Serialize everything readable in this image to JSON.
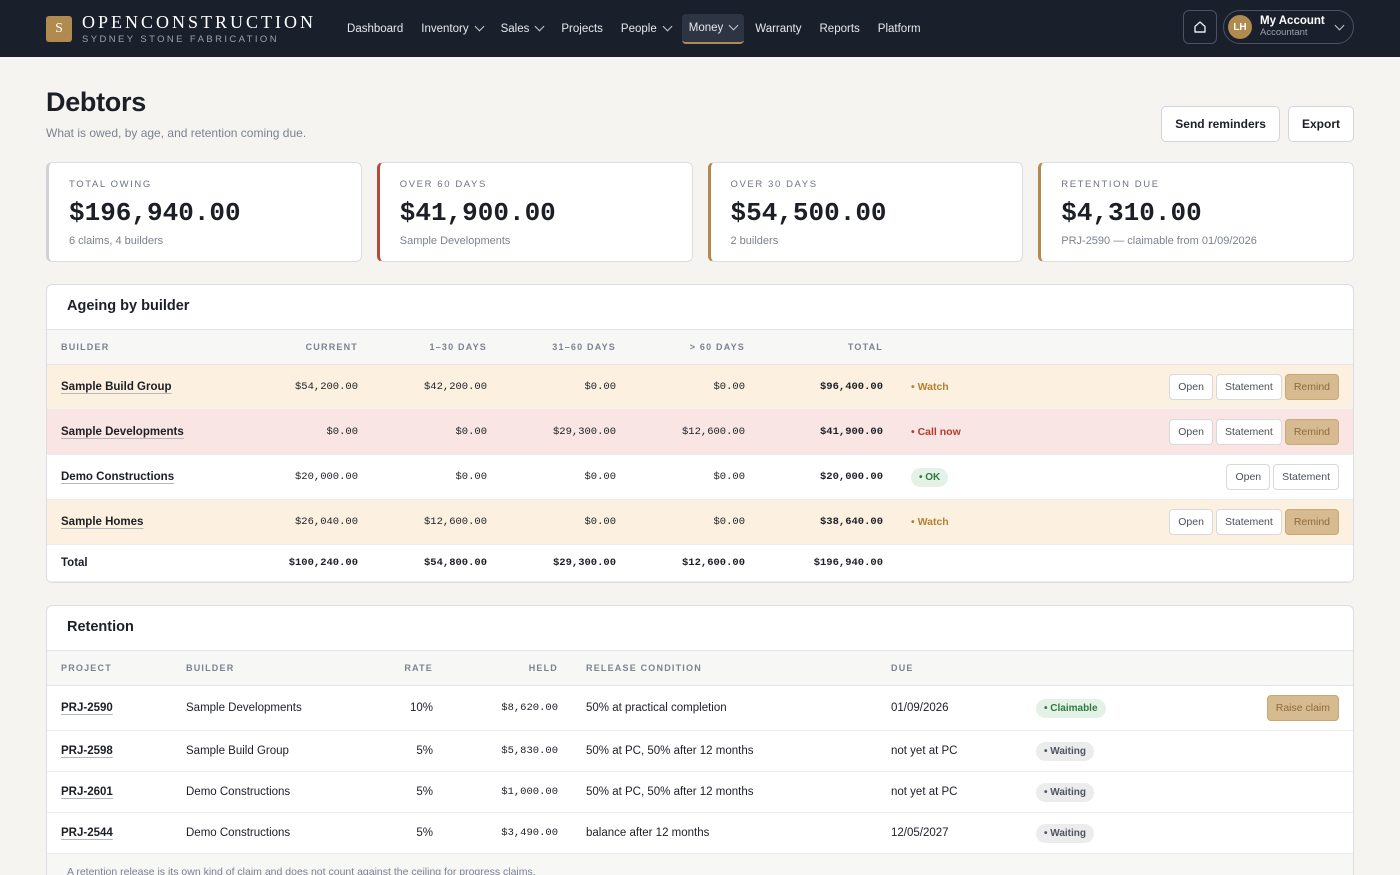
{
  "brand": {
    "mark": "S",
    "name": "OPENCONSTRUCTION",
    "sub": "SYDNEY STONE FABRICATION"
  },
  "nav": [
    {
      "label": "Dashboard",
      "dropdown": false,
      "active": false
    },
    {
      "label": "Inventory",
      "dropdown": true,
      "active": false
    },
    {
      "label": "Sales",
      "dropdown": true,
      "active": false
    },
    {
      "label": "Projects",
      "dropdown": false,
      "active": false
    },
    {
      "label": "People",
      "dropdown": true,
      "active": false
    },
    {
      "label": "Money",
      "dropdown": true,
      "active": true
    },
    {
      "label": "Warranty",
      "dropdown": false,
      "active": false
    },
    {
      "label": "Reports",
      "dropdown": false,
      "active": false
    },
    {
      "label": "Platform",
      "dropdown": false,
      "active": false
    }
  ],
  "account": {
    "initials": "LH",
    "name": "My Account",
    "role": "Accountant"
  },
  "page": {
    "title": "Debtors",
    "subtitle": "What is owed, by age, and retention coming due.",
    "send_label": "Send reminders",
    "export_label": "Export"
  },
  "cards": [
    {
      "label": "TOTAL OWING",
      "value": "$196,940.00",
      "note": "6 claims, 4 builders",
      "accent": "neutral"
    },
    {
      "label": "OVER 60 DAYS",
      "value": "$41,900.00",
      "note": "Sample Developments",
      "accent": "red"
    },
    {
      "label": "OVER 30 DAYS",
      "value": "$54,500.00",
      "note": "2 builders",
      "accent": "gold"
    },
    {
      "label": "RETENTION DUE",
      "value": "$4,310.00",
      "note": "PRJ-2590 — claimable from 01/09/2026",
      "accent": "gold"
    }
  ],
  "ageing": {
    "title": "Ageing by builder",
    "columns": [
      "BUILDER",
      "CURRENT",
      "1–30 DAYS",
      "31–60 DAYS",
      "> 60 DAYS",
      "TOTAL"
    ],
    "rows": [
      {
        "builder": "Sample Build Group",
        "current": "$54,200.00",
        "d30": "$42,200.00",
        "d60": "$0.00",
        "over60": "$0.00",
        "total": "$96,400.00",
        "status": "Watch",
        "status_type": "watch",
        "remind": true
      },
      {
        "builder": "Sample Developments",
        "current": "$0.00",
        "d30": "$0.00",
        "d60": "$29,300.00",
        "over60": "$12,600.00",
        "total": "$41,900.00",
        "status": "Call now",
        "status_type": "call",
        "remind": true
      },
      {
        "builder": "Demo Constructions",
        "current": "$20,000.00",
        "d30": "$0.00",
        "d60": "$0.00",
        "over60": "$0.00",
        "total": "$20,000.00",
        "status": "OK",
        "status_type": "ok",
        "remind": false
      },
      {
        "builder": "Sample Homes",
        "current": "$26,040.00",
        "d30": "$12,600.00",
        "d60": "$0.00",
        "over60": "$0.00",
        "total": "$38,640.00",
        "status": "Watch",
        "status_type": "watch",
        "remind": true
      }
    ],
    "total": {
      "label": "Total",
      "current": "$100,240.00",
      "d30": "$54,800.00",
      "d60": "$29,300.00",
      "over60": "$12,600.00",
      "total": "$196,940.00"
    },
    "open_label": "Open",
    "statement_label": "Statement",
    "remind_label": "Remind"
  },
  "retention": {
    "title": "Retention",
    "columns": [
      "PROJECT",
      "BUILDER",
      "RATE",
      "HELD",
      "RELEASE CONDITION",
      "DUE"
    ],
    "rows": [
      {
        "project": "PRJ-2590",
        "builder": "Sample Developments",
        "rate": "10%",
        "held": "$8,620.00",
        "condition": "50% at practical completion",
        "due": "01/09/2026",
        "status": "Claimable",
        "status_type": "claim",
        "action": "Raise claim"
      },
      {
        "project": "PRJ-2598",
        "builder": "Sample Build Group",
        "rate": "5%",
        "held": "$5,830.00",
        "condition": "50% at PC, 50% after 12 months",
        "due": "not yet at PC",
        "status": "Waiting",
        "status_type": "wait",
        "action": ""
      },
      {
        "project": "PRJ-2601",
        "builder": "Demo Constructions",
        "rate": "5%",
        "held": "$1,000.00",
        "condition": "50% at PC, 50% after 12 months",
        "due": "not yet at PC",
        "status": "Waiting",
        "status_type": "wait",
        "action": ""
      },
      {
        "project": "PRJ-2544",
        "builder": "Demo Constructions",
        "rate": "5%",
        "held": "$3,490.00",
        "condition": "balance after 12 months",
        "due": "12/05/2027",
        "status": "Waiting",
        "status_type": "wait",
        "action": ""
      }
    ],
    "footnote": "A retention release is its own kind of claim and does not count against the ceiling for progress claims."
  }
}
